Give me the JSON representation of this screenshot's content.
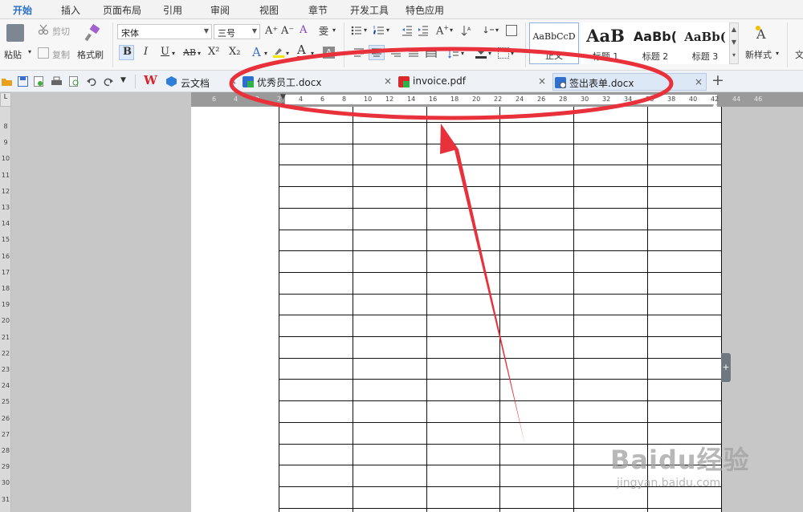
{
  "menu": {
    "tabs": [
      "开始",
      "插入",
      "页面布局",
      "引用",
      "审阅",
      "视图",
      "章节",
      "开发工具",
      "特色应用"
    ],
    "active_index": 0
  },
  "ribbon": {
    "paste_label": "粘贴",
    "cut_label": "剪切",
    "copy_label": "复制",
    "format_painter_label": "格式刷",
    "font_name": "宋体",
    "font_size": "三号",
    "bold": "B",
    "italic": "I",
    "underline": "U",
    "strikethrough": "AB",
    "superscript": "X²",
    "subscript": "X₂",
    "styles": [
      {
        "sample": "AaBbCcD",
        "label": "正文"
      },
      {
        "sample": "AaB",
        "label": "标题 1"
      },
      {
        "sample": "AaBb(",
        "label": "标题 2"
      },
      {
        "sample": "AaBb(",
        "label": "标题 3"
      }
    ],
    "new_style_label": "新样式",
    "truncated_label": "文"
  },
  "doc_tabs": {
    "cloud_docs": "云文档",
    "tabs": [
      {
        "label": "优秀员工.docx",
        "icon": "docx-icon"
      },
      {
        "label": "invoice.pdf",
        "icon": "pdf-icon"
      },
      {
        "label": "签出表单.docx",
        "icon": "docx-icon",
        "current": true
      }
    ],
    "new_tab": "+"
  },
  "ruler": {
    "horizontal_ticks": [
      "6",
      "4",
      "2",
      "2",
      "4",
      "6",
      "8",
      "10",
      "12",
      "14",
      "16",
      "18",
      "20",
      "22",
      "24",
      "26",
      "28",
      "30",
      "32",
      "34",
      "36",
      "38",
      "40",
      "42",
      "44",
      "46"
    ],
    "vertical_ticks": [
      "8",
      "9",
      "10",
      "11",
      "12",
      "13",
      "14",
      "15",
      "16",
      "17",
      "18",
      "19",
      "20",
      "21",
      "22",
      "23",
      "24",
      "25",
      "26",
      "27",
      "28",
      "29",
      "30",
      "31"
    ],
    "corner": "L"
  },
  "table": {
    "rows": 19,
    "columns": 6
  },
  "side_handle": "+",
  "watermark": {
    "brand": "Baidu经验",
    "url": "jingyan.baidu.com"
  },
  "colors": {
    "annotation": "#e8313a",
    "accent": "#2a6fc9",
    "canvas": "#c7c7c7"
  }
}
